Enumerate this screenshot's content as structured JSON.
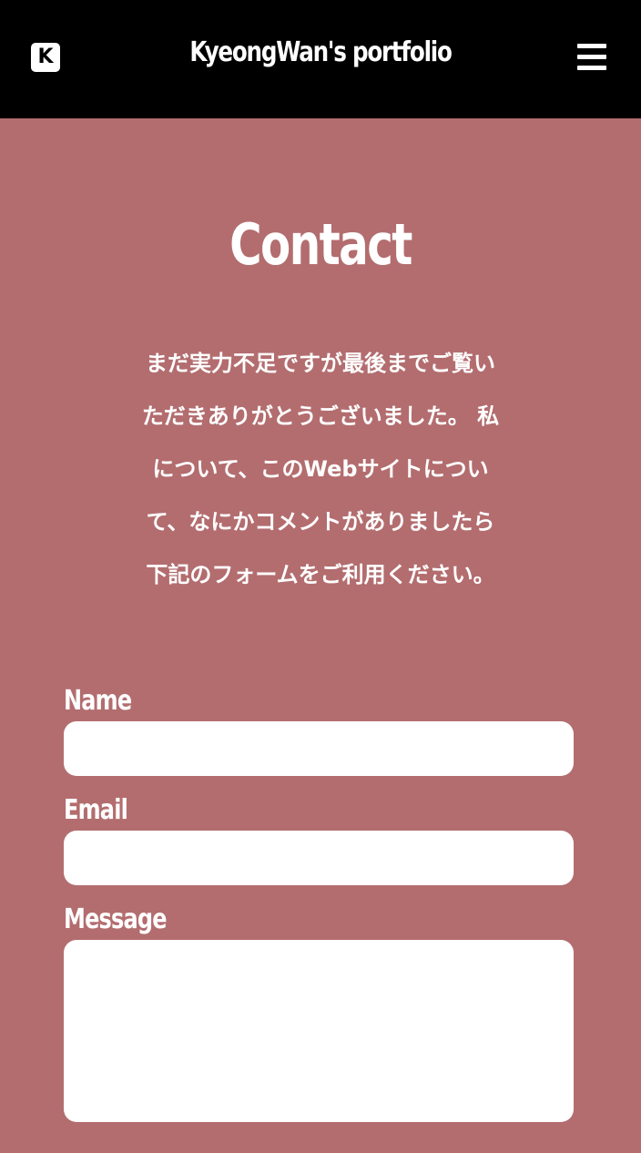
{
  "header": {
    "logo_letter": "K",
    "title": "KyeongWan's portfolio",
    "menu_icon": "hamburger-menu-icon"
  },
  "main": {
    "title": "Contact",
    "intro_lines": [
      "まだ実力不足ですが最後までご覧い",
      "ただきありがとうございました。 私",
      "について、このWebサイトについ",
      "て、なにかコメントがありましたら",
      "下記のフォームをご利用ください。"
    ]
  },
  "form": {
    "name_label": "Name",
    "name_value": "",
    "email_label": "Email",
    "email_value": "",
    "message_label": "Message",
    "message_value": ""
  },
  "colors": {
    "header_bg": "#000000",
    "page_bg": "#b36d6f",
    "text": "#ffffff",
    "input_bg": "#ffffff"
  }
}
